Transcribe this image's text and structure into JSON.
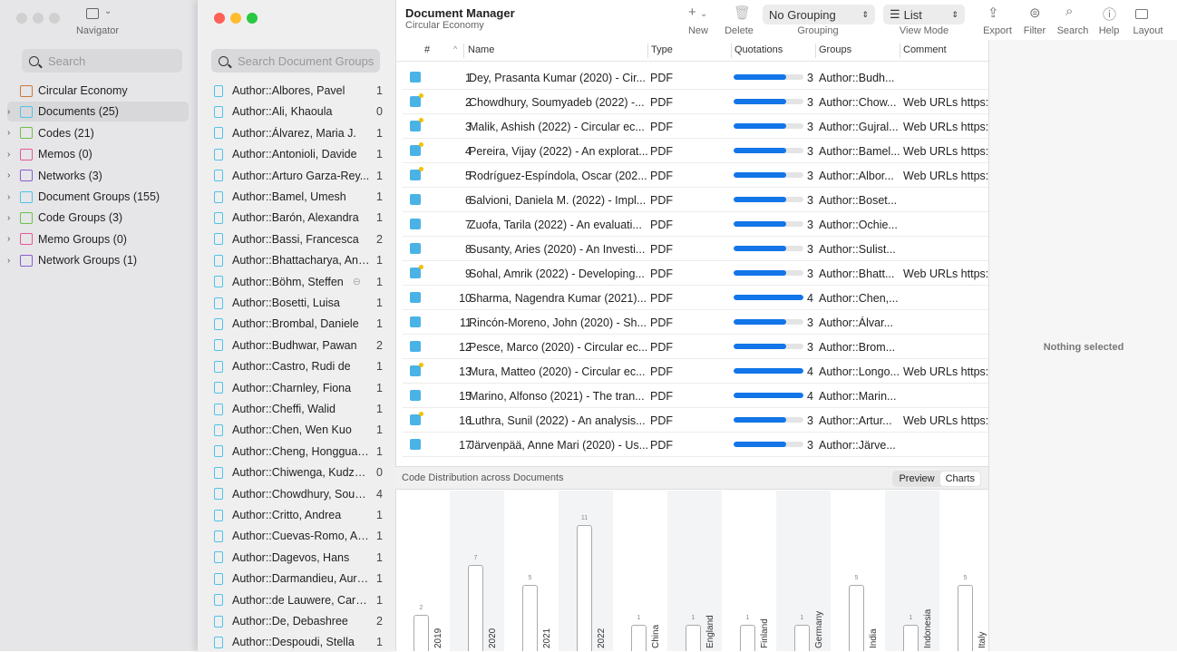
{
  "navigator": {
    "title": "Navigator",
    "search_placeholder": "Search",
    "items": [
      {
        "label": "Circular Economy",
        "icon": "briefcase-icon",
        "color": "#c87a3a",
        "expandable": false
      },
      {
        "label": "Documents (25)",
        "icon": "document-icon",
        "color": "#4fc3e8",
        "expandable": true,
        "selected": true
      },
      {
        "label": "Codes (21)",
        "icon": "code-diamond-icon",
        "color": "#6cc24a",
        "expandable": true
      },
      {
        "label": "Memos (0)",
        "icon": "memo-icon",
        "color": "#e8559a",
        "expandable": true
      },
      {
        "label": "Networks (3)",
        "icon": "network-icon",
        "color": "#8a5cd0",
        "expandable": true
      },
      {
        "label": "Document Groups (155)",
        "icon": "document-group-icon",
        "color": "#4fc3e8",
        "expandable": true
      },
      {
        "label": "Code Groups (3)",
        "icon": "code-group-icon",
        "color": "#6cc24a",
        "expandable": true
      },
      {
        "label": "Memo Groups (0)",
        "icon": "memo-group-icon",
        "color": "#e8559a",
        "expandable": true
      },
      {
        "label": "Network Groups (1)",
        "icon": "network-group-icon",
        "color": "#8a5cd0",
        "expandable": true
      }
    ]
  },
  "doc_groups": {
    "search_placeholder": "Search Document Groups",
    "items": [
      {
        "name": "Author::Albores, Pavel",
        "count": "1"
      },
      {
        "name": "Author::Ali, Khaoula",
        "count": "0"
      },
      {
        "name": "Author::Álvarez, Maria J.",
        "count": "1"
      },
      {
        "name": "Author::Antonioli, Davide",
        "count": "1"
      },
      {
        "name": "Author::Arturo Garza-Rey...",
        "count": "1"
      },
      {
        "name": "Author::Bamel, Umesh",
        "count": "1"
      },
      {
        "name": "Author::Barón, Alexandra",
        "count": "1"
      },
      {
        "name": "Author::Bassi, Francesca",
        "count": "2"
      },
      {
        "name": "Author::Bhattacharya, Ana...",
        "count": "1"
      },
      {
        "name": "Author::Böhm, Steffen",
        "count": "1"
      },
      {
        "name": "Author::Bosetti, Luisa",
        "count": "1"
      },
      {
        "name": "Author::Brombal, Daniele",
        "count": "1"
      },
      {
        "name": "Author::Budhwar, Pawan",
        "count": "2"
      },
      {
        "name": "Author::Castro, Rudi de",
        "count": "1"
      },
      {
        "name": "Author::Charnley, Fiona",
        "count": "1"
      },
      {
        "name": "Author::Cheffi, Walid",
        "count": "1"
      },
      {
        "name": "Author::Chen, Wen Kuo",
        "count": "1"
      },
      {
        "name": "Author::Cheng, Hongguang",
        "count": "1"
      },
      {
        "name": "Author::Chiwenga, Kudzai...",
        "count": "0"
      },
      {
        "name": "Author::Chowdhury, Soum...",
        "count": "4"
      },
      {
        "name": "Author::Critto, Andrea",
        "count": "1"
      },
      {
        "name": "Author::Cuevas-Romo, Ana",
        "count": "1"
      },
      {
        "name": "Author::Dagevos, Hans",
        "count": "1"
      },
      {
        "name": "Author::Darmandieu, Aurore",
        "count": "1"
      },
      {
        "name": "Author::de Lauwere, Caroli...",
        "count": "1"
      },
      {
        "name": "Author::De, Debashree",
        "count": "2"
      },
      {
        "name": "Author::Despoudi, Stella",
        "count": "1"
      }
    ]
  },
  "header": {
    "title": "Document Manager",
    "subtitle": "Circular Economy",
    "toolbar": {
      "new": "New",
      "delete": "Delete",
      "grouping_label": "Grouping",
      "grouping_value": "No Grouping",
      "viewmode_label": "View Mode",
      "viewmode_value": "List",
      "export": "Export",
      "filter": "Filter",
      "search": "Search",
      "help": "Help",
      "layout": "Layout"
    }
  },
  "table": {
    "columns": {
      "num": "#",
      "name": "Name",
      "type": "Type",
      "quotations": "Quotations",
      "groups": "Groups",
      "comment": "Comment"
    },
    "max_quotations": 4,
    "accent": "#1275e8",
    "rows": [
      {
        "n": "1",
        "name": "Dey, Prasanta Kumar (2020) - Cir...",
        "type": "PDF",
        "q": 3,
        "group": "Author::Budh...",
        "comment": "",
        "flag": false
      },
      {
        "n": "2",
        "name": "Chowdhury, Soumyadeb (2022) -...",
        "type": "PDF",
        "q": 3,
        "group": "Author::Chow...",
        "comment": "Web URLs https:/",
        "flag": true
      },
      {
        "n": "3",
        "name": "Malik, Ashish (2022) - Circular ec...",
        "type": "PDF",
        "q": 3,
        "group": "Author::Gujral...",
        "comment": "Web URLs https:/",
        "flag": true
      },
      {
        "n": "4",
        "name": "Pereira, Vijay (2022) - An explorat...",
        "type": "PDF",
        "q": 3,
        "group": "Author::Bamel...",
        "comment": "Web URLs https:/",
        "flag": true
      },
      {
        "n": "5",
        "name": "Rodríguez-Espíndola, Oscar (202...",
        "type": "PDF",
        "q": 3,
        "group": "Author::Albor...",
        "comment": "Web URLs https:/",
        "flag": true
      },
      {
        "n": "6",
        "name": "Salvioni, Daniela M. (2022) - Impl...",
        "type": "PDF",
        "q": 3,
        "group": "Author::Boset...",
        "comment": "",
        "flag": false
      },
      {
        "n": "7",
        "name": "Zuofa, Tarila (2022) - An evaluati...",
        "type": "PDF",
        "q": 3,
        "group": "Author::Ochie...",
        "comment": "",
        "flag": false
      },
      {
        "n": "8",
        "name": "Susanty, Aries (2020) - An Investi...",
        "type": "PDF",
        "q": 3,
        "group": "Author::Sulist...",
        "comment": "",
        "flag": false
      },
      {
        "n": "9",
        "name": "Sohal, Amrik (2022) - Developing...",
        "type": "PDF",
        "q": 3,
        "group": "Author::Bhatt...",
        "comment": "Web URLs https:/",
        "flag": true
      },
      {
        "n": "10",
        "name": "Sharma, Nagendra Kumar (2021)...",
        "type": "PDF",
        "q": 4,
        "group": "Author::Chen,...",
        "comment": "",
        "flag": false
      },
      {
        "n": "11",
        "name": "Rincón-Moreno, John (2020) - Sh...",
        "type": "PDF",
        "q": 3,
        "group": "Author::Álvar...",
        "comment": "",
        "flag": false
      },
      {
        "n": "12",
        "name": "Pesce, Marco (2020) - Circular ec...",
        "type": "PDF",
        "q": 3,
        "group": "Author::Brom...",
        "comment": "",
        "flag": false
      },
      {
        "n": "13",
        "name": "Mura, Matteo (2020) - Circular ec...",
        "type": "PDF",
        "q": 4,
        "group": "Author::Longo...",
        "comment": "Web URLs https:/",
        "flag": true
      },
      {
        "n": "15",
        "name": "Marino, Alfonso (2021) - The tran...",
        "type": "PDF",
        "q": 4,
        "group": "Author::Marin...",
        "comment": "",
        "flag": false
      },
      {
        "n": "16",
        "name": "Luthra, Sunil (2022) - An analysis...",
        "type": "PDF",
        "q": 3,
        "group": "Author::Artur...",
        "comment": "Web URLs https:/",
        "flag": true
      },
      {
        "n": "17",
        "name": "Järvenpää, Anne Mari (2020) - Us...",
        "type": "PDF",
        "q": 3,
        "group": "Author::Järve...",
        "comment": "",
        "flag": false
      }
    ]
  },
  "chart_panel": {
    "title": "Code Distribution across Documents",
    "tabs": [
      "Preview",
      "Charts"
    ],
    "active_tab": "Charts"
  },
  "chart_data": {
    "type": "bar",
    "title": "",
    "categories": [
      "2019",
      "2020",
      "2021",
      "2022",
      "China",
      "England",
      "Finland",
      "Germany",
      "India",
      "Indonesia",
      "Italy"
    ],
    "values": [
      2,
      7,
      5,
      11,
      1,
      1,
      1,
      1,
      5,
      1,
      5
    ]
  },
  "side": {
    "empty_text": "Nothing selected"
  }
}
